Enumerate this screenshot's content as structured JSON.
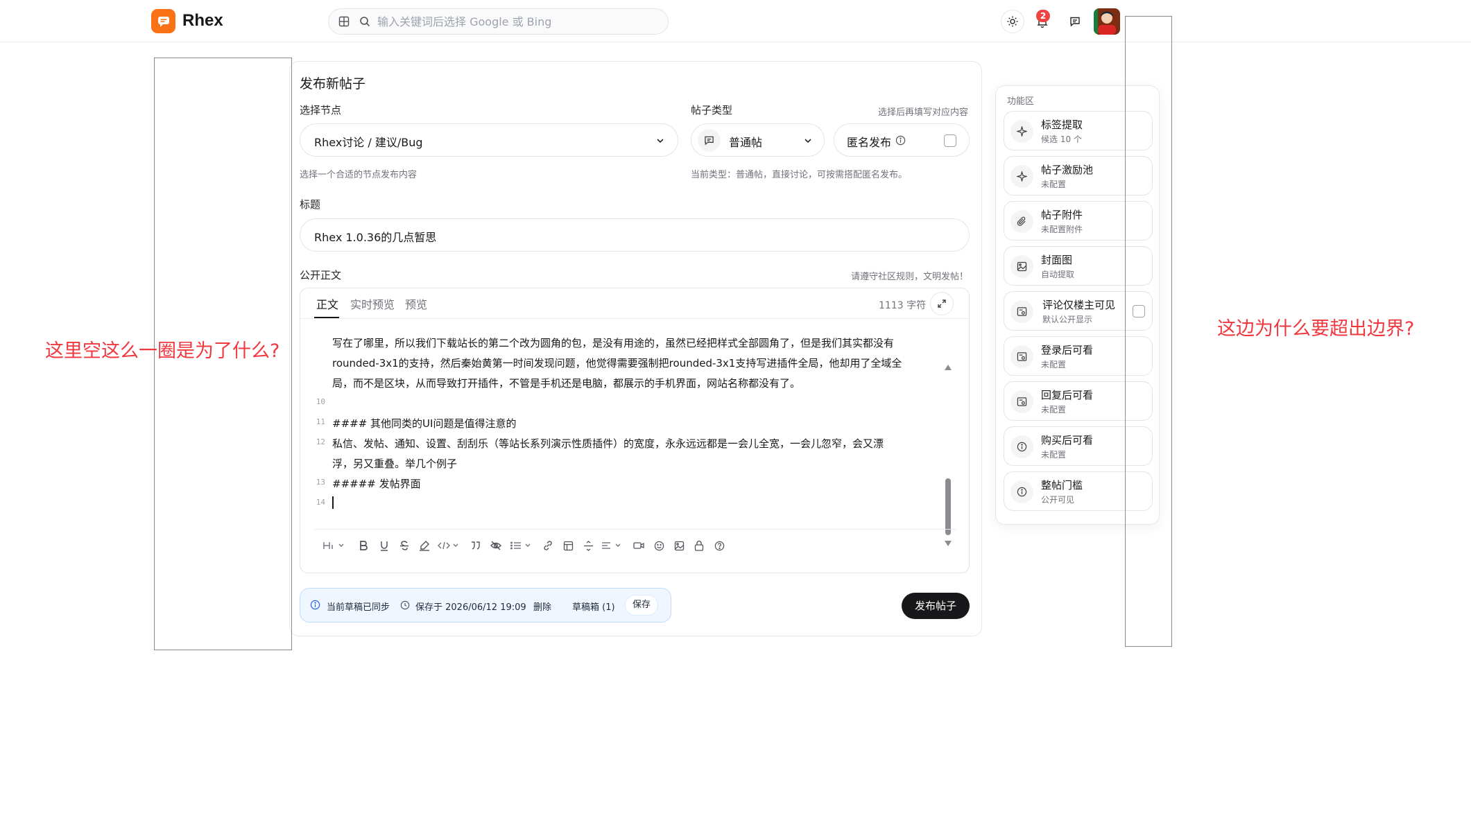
{
  "app": {
    "brand": "Rhex"
  },
  "search": {
    "placeholder": "输入关键词后选择 Google 或 Bing"
  },
  "header": {
    "notification_count": "2"
  },
  "form": {
    "title": "发布新帖子",
    "node": {
      "label": "选择节点",
      "value": "Rhex讨论 / 建议/Bug",
      "hint": "选择一个合适的节点发布内容"
    },
    "type": {
      "label": "帖子类型",
      "right_hint": "选择后再填写对应内容",
      "value": "普通帖",
      "hint": "当前类型：普通帖，直接讨论，可按需搭配匿名发布。"
    },
    "anonymous": {
      "label": "匿名发布"
    },
    "post_title": {
      "label": "标题",
      "value": "Rhex 1.0.36的几点暂思"
    },
    "body": {
      "label": "公开正文",
      "rule_hint": "请遵守社区规则，文明发帖！"
    }
  },
  "editor": {
    "tabs": [
      "正文",
      "实时预览",
      "预览"
    ],
    "char_count": "1113 字符",
    "lines": [
      {
        "num": "",
        "text": "写在了哪里，所以我们下载站长的第二个改为圆角的包，是没有用途的，虽然已经把样式全部圆角了，但是我们其实都没有"
      },
      {
        "num": "",
        "text": "rounded-3x1的支持，然后秦始黄第一时间发现问题，他觉得需要强制把rounded-3x1支持写进插件全局，他却用了全域全"
      },
      {
        "num": "",
        "text": "局，而不是区块，从而导致打开插件，不管是手机还是电脑，都展示的手机界面，网站名称都没有了。"
      },
      {
        "num": "10",
        "text": ""
      },
      {
        "num": "11",
        "text": "#### 其他同类的UI问题是值得注意的"
      },
      {
        "num": "12",
        "text": "私信、发帖、通知、设置、刮刮乐（等站长系列演示性质插件）的宽度，永永远远都是一会儿全宽，一会儿忽窄，会又漂"
      },
      {
        "num": "",
        "text": "浮，另又重叠。举几个例子"
      },
      {
        "num": "13",
        "text": "##### 发帖界面"
      },
      {
        "num": "14",
        "text": ""
      }
    ],
    "toolbar": [
      "heading-icon",
      "bold-icon",
      "underline-icon",
      "strikethrough-icon",
      "highlight-icon",
      "code-icon",
      "quote-icon",
      "hide-icon",
      "list-icon",
      "link-icon",
      "table-icon",
      "divider-icon",
      "align-icon",
      "video-icon",
      "emoji-icon",
      "image-icon",
      "lock-icon",
      "help-icon"
    ]
  },
  "draft": {
    "status": "当前草稿已同步",
    "saved_at": "保存于 2026/06/12 19:09",
    "delete": "删除",
    "drafts": "草稿箱 (1)",
    "save": "保存"
  },
  "publish_button": "发布帖子",
  "panel": {
    "title": "功能区",
    "items": [
      {
        "name": "标签提取",
        "sub": "候选 10 个",
        "icon": "sparkle-icon"
      },
      {
        "name": "帖子激励池",
        "sub": "未配置",
        "icon": "sparkle-icon"
      },
      {
        "name": "帖子附件",
        "sub": "未配置附件",
        "icon": "paperclip-icon"
      },
      {
        "name": "封面图",
        "sub": "自动提取",
        "icon": "image-icon"
      },
      {
        "name": "评论仅楼主可见",
        "sub": "默认公开显示",
        "icon": "eye-card-icon"
      },
      {
        "name": "登录后可看",
        "sub": "未配置",
        "icon": "eye-card-icon"
      },
      {
        "name": "回复后可看",
        "sub": "未配置",
        "icon": "eye-card-icon"
      },
      {
        "name": "购买后可看",
        "sub": "未配置",
        "icon": "info-icon"
      },
      {
        "name": "整帖门槛",
        "sub": "公开可见",
        "icon": "info-icon"
      }
    ]
  },
  "annotations": {
    "left": "这里空这么一圈是为了什么?",
    "right": "这边为什么要超出边界?",
    "color": "#f0383f"
  }
}
